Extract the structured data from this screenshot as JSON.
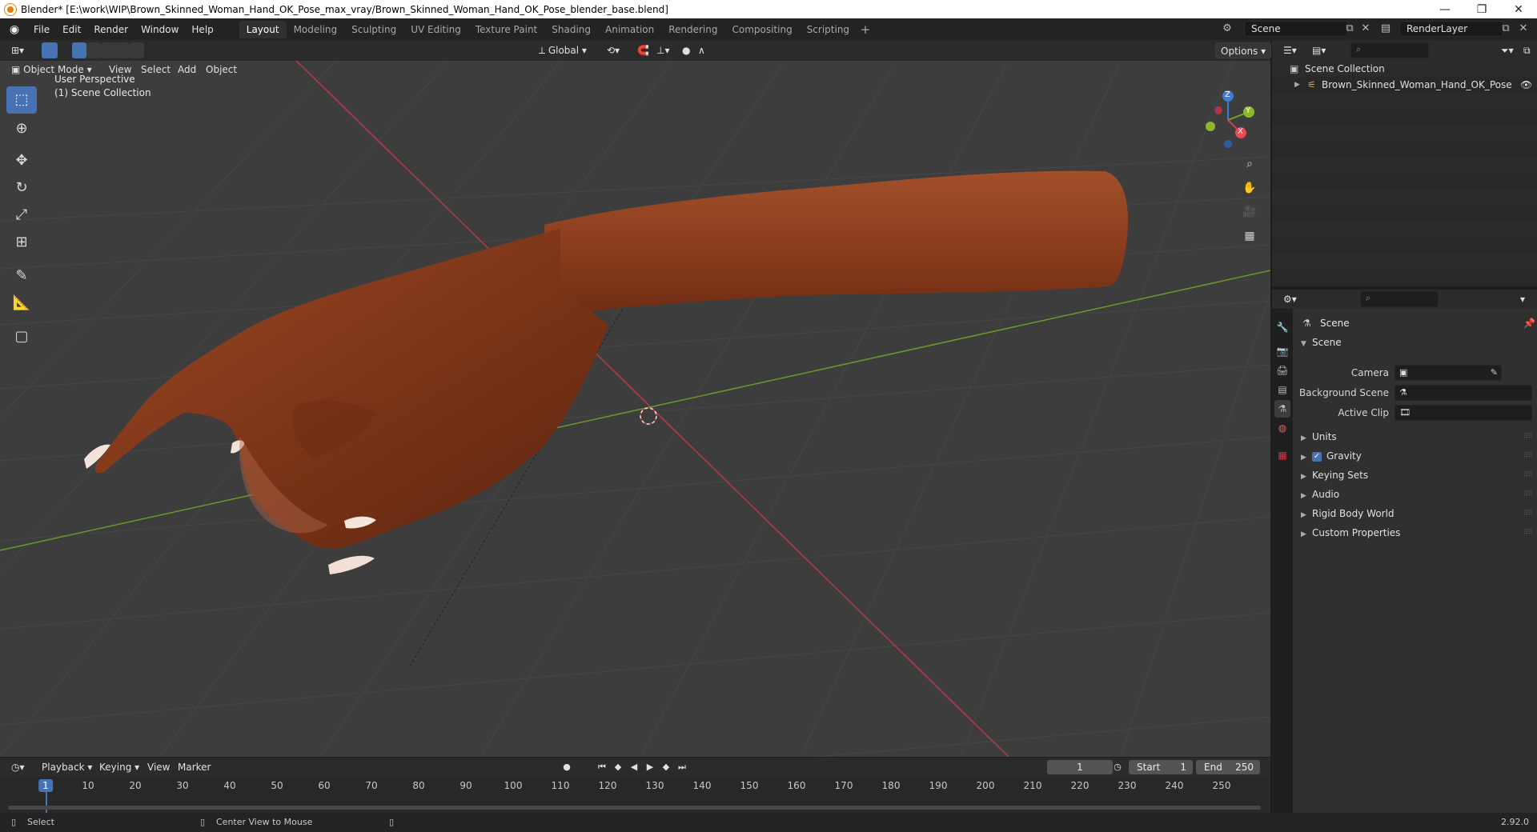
{
  "window": {
    "title": "Blender* [E:\\work\\WIP\\Brown_Skinned_Woman_Hand_OK_Pose_max_vray/Brown_Skinned_Woman_Hand_OK_Pose_blender_base.blend]",
    "minimize": "—",
    "restore": "❐",
    "close": "✕"
  },
  "menu": [
    "File",
    "Edit",
    "Render",
    "Window",
    "Help"
  ],
  "workspaces": [
    "Layout",
    "Modeling",
    "Sculpting",
    "UV Editing",
    "Texture Paint",
    "Shading",
    "Animation",
    "Rendering",
    "Compositing",
    "Scripting"
  ],
  "active_workspace": "Layout",
  "scene_name": "Scene",
  "render_layer": "RenderLayer",
  "viewport": {
    "mode": "Object Mode",
    "menus": [
      "View",
      "Select",
      "Add",
      "Object"
    ],
    "transform_orientation": "Global",
    "options": "Options",
    "overlay_line1": "User Perspective",
    "overlay_line2": "(1) Scene Collection",
    "gizmo": {
      "z": "Z",
      "y": "Y",
      "x": "X"
    }
  },
  "tools": [
    "select-box",
    "cursor",
    "move",
    "rotate",
    "scale",
    "transform",
    "annotate",
    "measure",
    "add-cube"
  ],
  "outliner": {
    "root": "Scene Collection",
    "items": [
      "Brown_Skinned_Woman_Hand_OK_Pose"
    ]
  },
  "properties": {
    "header": "Scene",
    "section": "Scene",
    "fields": [
      {
        "label": "Camera"
      },
      {
        "label": "Background Scene"
      },
      {
        "label": "Active Clip"
      }
    ],
    "panels": [
      "Units",
      "Gravity",
      "Keying Sets",
      "Audio",
      "Rigid Body World",
      "Custom Properties"
    ],
    "gravity_checked": true
  },
  "timeline": {
    "menus": [
      "Playback",
      "Keying",
      "View",
      "Marker"
    ],
    "current_frame": "1",
    "start_label": "Start",
    "start": "1",
    "end_label": "End",
    "end": "250",
    "ticks": [
      "10",
      "20",
      "30",
      "40",
      "50",
      "60",
      "70",
      "80",
      "90",
      "100",
      "110",
      "120",
      "130",
      "140",
      "150",
      "160",
      "170",
      "180",
      "190",
      "200",
      "210",
      "220",
      "230",
      "240",
      "250"
    ],
    "cursor_label": "1"
  },
  "status": {
    "select": "Select",
    "center": "Center View to Mouse",
    "version": "2.92.0"
  }
}
